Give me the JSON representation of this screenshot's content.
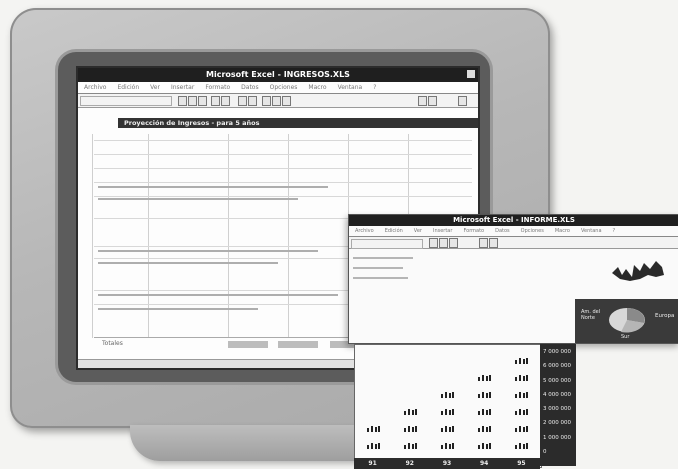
{
  "window_main": {
    "title": "Microsoft Excel - INGRESOS.XLS",
    "menu": [
      "Archivo",
      "Edición",
      "Ver",
      "Insertar",
      "Formato",
      "Datos",
      "Opciones",
      "Macro",
      "Ventana",
      "?"
    ],
    "sheet_heading": "Proyección de Ingresos - para 5 años",
    "status_label": "Totales"
  },
  "window_overlay": {
    "title": "Microsoft Excel - INFORME.XLS",
    "menu": [
      "Archivo",
      "Edición",
      "Ver",
      "Insertar",
      "Formato",
      "Datos",
      "Opciones",
      "Macro",
      "Ventana",
      "?"
    ],
    "pie_labels": {
      "left": "Am. del Norte",
      "right": "Europa",
      "bottom": "Sur"
    }
  },
  "chart_data": {
    "type": "bar",
    "categories": [
      "91",
      "92",
      "93",
      "94",
      "95"
    ],
    "y_ticks": [
      "7 000 000",
      "6 000 000",
      "5 000 000",
      "4 000 000",
      "3 000 000",
      "2 000 000",
      "1 000 000",
      "0"
    ],
    "ylim": [
      0,
      7000000
    ],
    "stacks": [
      2,
      3,
      4,
      5,
      6
    ]
  }
}
